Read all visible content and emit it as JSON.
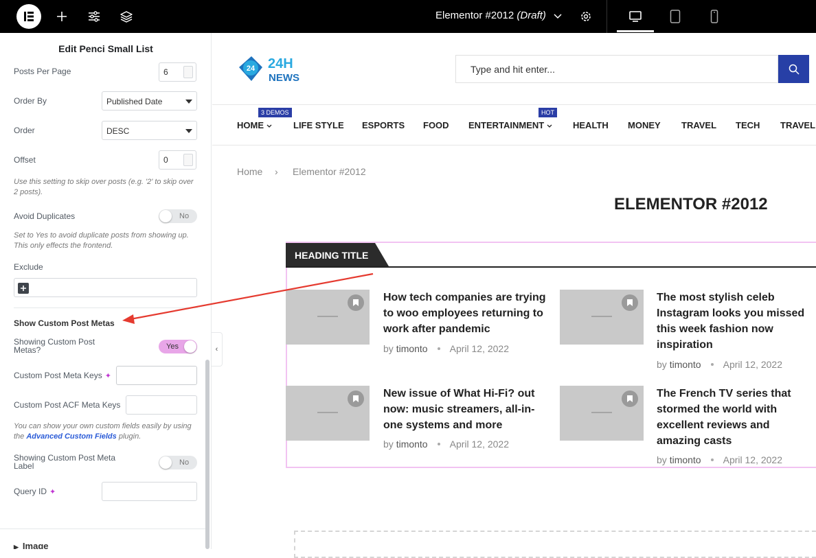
{
  "topbar": {
    "doc_title": "Elementor #2012",
    "doc_status": "(Draft)"
  },
  "panel": {
    "title": "Edit Penci Small List",
    "posts_per_page": {
      "label": "Posts Per Page",
      "value": "6"
    },
    "order_by": {
      "label": "Order By",
      "value": "Published Date"
    },
    "order": {
      "label": "Order",
      "value": "DESC"
    },
    "offset": {
      "label": "Offset",
      "value": "0",
      "help": "Use this setting to skip over posts (e.g. '2' to skip over 2 posts)."
    },
    "avoid_duplicates": {
      "label": "Avoid Duplicates",
      "value": "No",
      "help": "Set to Yes to avoid duplicate posts from showing up. This only effects the frontend."
    },
    "exclude": {
      "label": "Exclude"
    },
    "section_title": "Show Custom Post Metas",
    "showing_custom": {
      "label": "Showing Custom Post Metas?",
      "value": "Yes"
    },
    "meta_keys": {
      "label": "Custom Post Meta Keys"
    },
    "acf_keys": {
      "label": "Custom Post ACF Meta Keys"
    },
    "acf_help_before": "You can show your own custom fields easily by using the",
    "acf_help_link": "Advanced Custom Fields",
    "acf_help_after": "plugin.",
    "meta_label": {
      "label": "Showing Custom Post Meta Label",
      "value": "No"
    },
    "query_id": {
      "label": "Query ID"
    },
    "image_section": "Image"
  },
  "site": {
    "logo_text_top": "24H",
    "logo_text_bottom": "NEWS",
    "logo_badge": "24",
    "search_placeholder": "Type and hit enter...",
    "nav": [
      {
        "label": "HOME",
        "badge": "3 DEMOS"
      },
      {
        "label": "LIFE STYLE"
      },
      {
        "label": "ESPORTS"
      },
      {
        "label": "FOOD"
      },
      {
        "label": "ENTERTAINMENT",
        "badge": "HOT"
      },
      {
        "label": "HEALTH"
      },
      {
        "label": "MONEY"
      },
      {
        "label": "TRAVEL"
      },
      {
        "label": "TECH"
      },
      {
        "label": "TRAVEL"
      }
    ],
    "breadcrumb": {
      "home": "Home",
      "sep": "›",
      "current": "Elementor #2012"
    },
    "page_title": "ELEMENTOR #2012",
    "heading_title": "HEADING TITLE",
    "posts": [
      {
        "title": "How tech companies are trying to woo employees returning to work after pandemic",
        "author": "timonto",
        "date": "April 12, 2022"
      },
      {
        "title": "The most stylish celeb Instagram looks you missed this week fashion now inspiration",
        "author": "timonto",
        "date": "April 12, 2022"
      },
      {
        "title": "New issue of What Hi-Fi? out now: music streamers, all-in-one systems and more",
        "author": "timonto",
        "date": "April 12, 2022"
      },
      {
        "title": "The French TV series that stormed the world with excellent reviews and amazing casts",
        "author": "timonto",
        "date": "April 12, 2022"
      }
    ],
    "by_label": "by"
  },
  "colors": {
    "accent": "#273fa6",
    "toggle_on": "#e8a6e8",
    "annotation_arrow": "#e53a2f"
  },
  "icons": [
    "elementor-logo-icon",
    "plus-icon",
    "sliders-icon",
    "layers-icon",
    "chevron-down-icon",
    "gear-icon",
    "desktop-icon",
    "tablet-icon",
    "mobile-icon",
    "search-icon",
    "bookmark-icon"
  ]
}
